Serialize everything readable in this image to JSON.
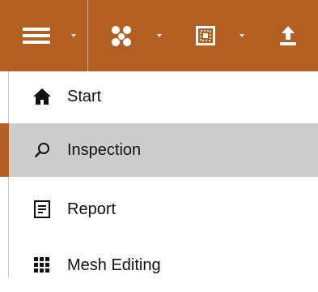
{
  "toolbar": {
    "background_color": "#b35f22",
    "buttons": [
      {
        "icon": "hamburger-menu-icon",
        "has_dropdown": true
      },
      {
        "icon": "network-nodes-icon",
        "has_dropdown": true
      },
      {
        "icon": "fit-view-icon",
        "has_dropdown": true
      },
      {
        "icon": "export-upload-icon",
        "has_dropdown": false
      }
    ]
  },
  "menu": {
    "accent_color": "#b35f22",
    "active_background": "#cdcdcd",
    "items": [
      {
        "label": "Start",
        "icon": "home-icon",
        "active": false
      },
      {
        "label": "Inspection",
        "icon": "search-icon",
        "active": true
      },
      {
        "label": "Report",
        "icon": "report-document-icon",
        "active": false
      },
      {
        "label": "Mesh Editing",
        "icon": "mesh-grid-icon",
        "active": false
      }
    ]
  }
}
